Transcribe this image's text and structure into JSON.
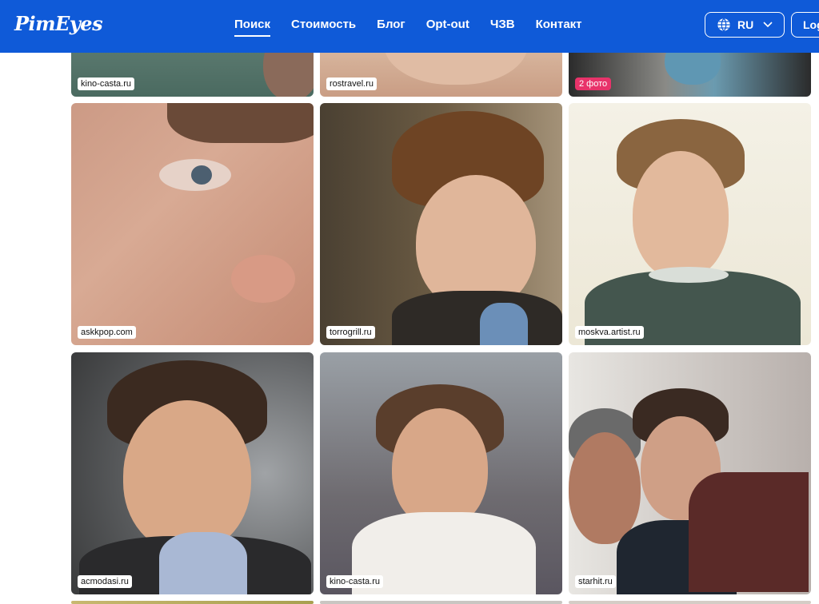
{
  "header": {
    "logo": "PimEyes",
    "nav": [
      {
        "label": "Поиск",
        "active": true
      },
      {
        "label": "Стоимость",
        "active": false
      },
      {
        "label": "Блог",
        "active": false
      },
      {
        "label": "Opt-out",
        "active": false
      },
      {
        "label": "ЧЗВ",
        "active": false
      },
      {
        "label": "Контакт",
        "active": false
      }
    ],
    "language": "RU",
    "login": "Log"
  },
  "results": [
    {
      "source": "kino-casta.ru",
      "badge": ""
    },
    {
      "source": "rostravel.ru",
      "badge": ""
    },
    {
      "source": "",
      "badge": "2 фото"
    },
    {
      "source": "askkpop.com",
      "badge": ""
    },
    {
      "source": "torrogrill.ru",
      "badge": ""
    },
    {
      "source": "moskva.artist.ru",
      "badge": ""
    },
    {
      "source": "acmodasi.ru",
      "badge": ""
    },
    {
      "source": "kino-casta.ru",
      "badge": ""
    },
    {
      "source": "starhit.ru",
      "badge": ""
    }
  ],
  "colors": {
    "brand": "#0f5ad8",
    "badge": "#e8336a"
  }
}
